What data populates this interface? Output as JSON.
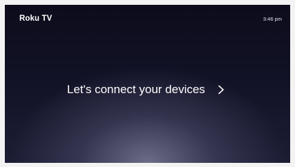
{
  "header": {
    "brand": "Roku TV",
    "time": "3:46 pm"
  },
  "main": {
    "prompt": "Let's connect your devices",
    "next_icon": "chevron-right-icon"
  },
  "colors": {
    "background_top": "#0c0c1c",
    "background_glow": "#7a7a98",
    "text": "#ffffff"
  }
}
